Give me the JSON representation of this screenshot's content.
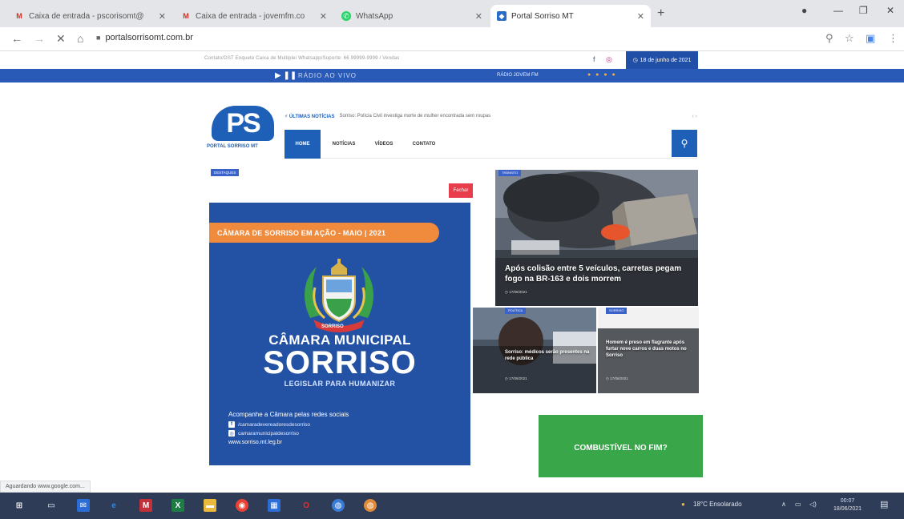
{
  "browser": {
    "tabs": [
      {
        "icon": "gmail-icon",
        "title": "Caixa de entrada - pscorisomt@",
        "active": false
      },
      {
        "icon": "gmail-icon",
        "title": "Caixa de entrada - jovemfm.co",
        "active": false
      },
      {
        "icon": "whatsapp-icon",
        "title": "WhatsApp",
        "active": false
      },
      {
        "icon": "portal-favicon",
        "title": "Portal Sorriso MT",
        "active": true
      }
    ],
    "url": "portalsorrisomt.com.br",
    "status_text": "Aguardando www.google.com..."
  },
  "site": {
    "top_links": "Contato/DST    Enquete    Caixa de Multiplei    Whatsapp/Suporte: 66 99999-9999 / Vendas",
    "date": "18 de junho de 2021",
    "logo_text": "PS",
    "logo_caption": "PORTAL SORRISO MT",
    "radio": {
      "label": "RÁDIO AO VIVO",
      "station": "RÁDIO JOVEM FM"
    },
    "ticker": {
      "label": "ÚLTIMAS NOTÍCIAS",
      "text": "Sorriso: Polícia Civil investiga morte de mulher encontrada sem roupas"
    },
    "nav": [
      "HOME",
      "NOTÍCIAS",
      "VÍDEOS",
      "CONTATO"
    ],
    "section_tag": "DESTAQUES",
    "close_label": "Fechar"
  },
  "ad": {
    "banner": "CÂMARA DE SORRISO EM AÇÃO - MAIO | 2021",
    "emblem_text": "SORRISO",
    "title_line1": "CÂMARA MUNICIPAL",
    "title_line2": "SORRISO",
    "tagline": "LEGISLAR PARA HUMANIZAR",
    "follow": "Acompanhe a Câmara pelas redes sociais",
    "facebook": "/camaradevereadoresdesorriso",
    "instagram": "camaramunicipaldesorriso",
    "site": "www.sorriso.mt.leg.br"
  },
  "news": [
    {
      "tag": "TRÂNSITO",
      "headline": "Após colisão entre 5 veículos, carretas pegam fogo na BR-163 e dois morrem",
      "date": "17/06/2021"
    },
    {
      "tag": "POLÍTICA",
      "headline": "Sorriso: médicos serão presentes na rede pública",
      "date": "17/06/2021"
    },
    {
      "tag": "SORRISO",
      "headline": "Homem é preso em flagrante após furtar nove carros e duas motos no Sorriso",
      "date": "17/06/2021"
    }
  ],
  "fuel_ad": "COMBUSTÍVEL NO FIM?",
  "taskbar": {
    "weather": "18°C  Ensolarado",
    "time": "00:07",
    "date": "18/06/2021"
  }
}
